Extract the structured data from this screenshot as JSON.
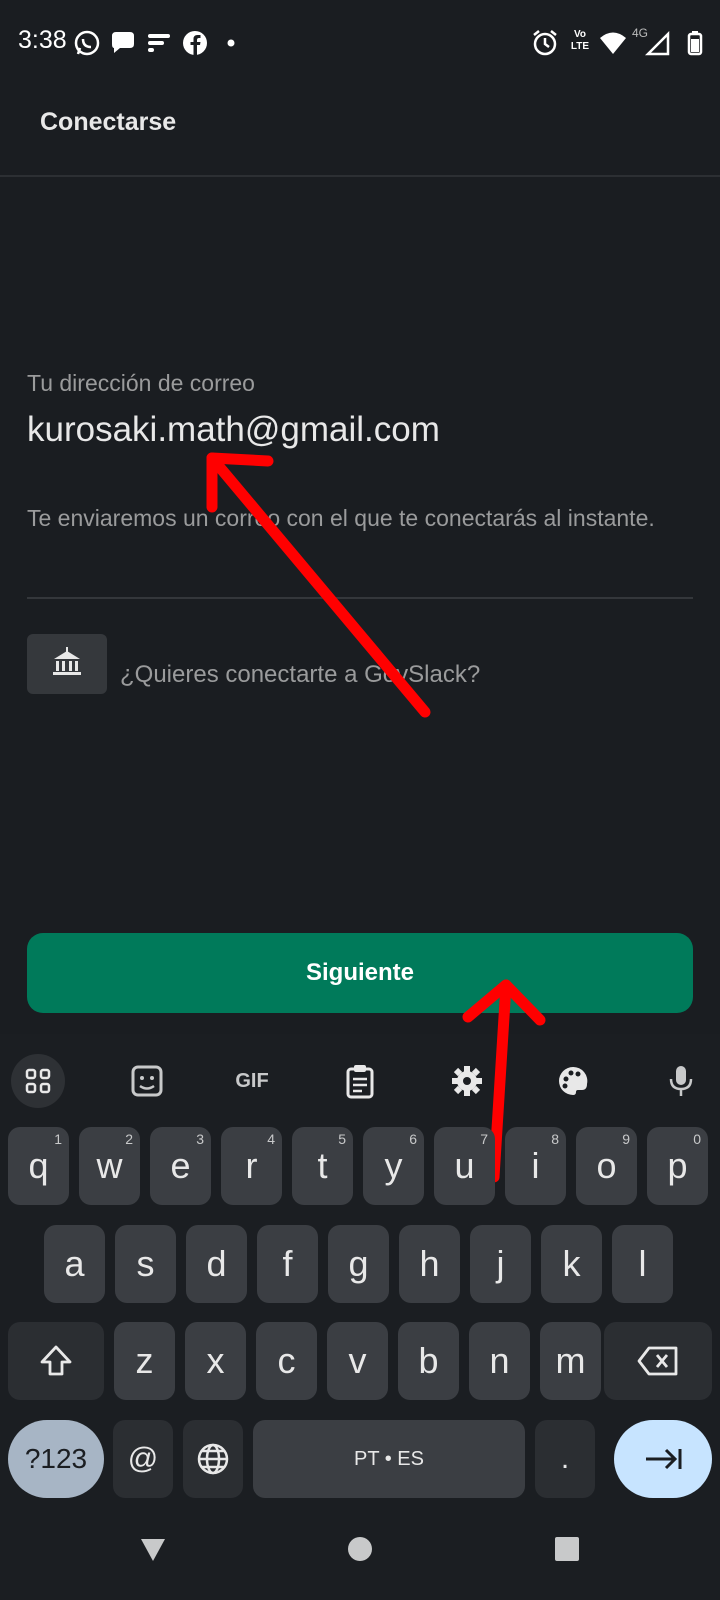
{
  "status_bar": {
    "time": "3:38",
    "network": "4G",
    "volte": "Vo LTE"
  },
  "header": {
    "title": "Conectarse"
  },
  "form": {
    "email_label": "Tu dirección de correo",
    "email_value": "kurosaki.math@gmail.com",
    "helper_text": "Te enviaremos un correo con el que te conectarás al instante.",
    "govslack_prompt": "¿Quieres conectarte a GovSlack?"
  },
  "primary_button": {
    "label": "Siguiente",
    "color": "#007a5a"
  },
  "keyboard": {
    "toolbar": [
      "apps-grid-icon",
      "sticker-icon",
      "gif-icon",
      "clipboard-icon",
      "settings-icon",
      "palette-icon",
      "mic-icon"
    ],
    "gif_label": "GIF",
    "row1": [
      {
        "k": "q",
        "n": "1"
      },
      {
        "k": "w",
        "n": "2"
      },
      {
        "k": "e",
        "n": "3"
      },
      {
        "k": "r",
        "n": "4"
      },
      {
        "k": "t",
        "n": "5"
      },
      {
        "k": "y",
        "n": "6"
      },
      {
        "k": "u",
        "n": "7"
      },
      {
        "k": "i",
        "n": "8"
      },
      {
        "k": "o",
        "n": "9"
      },
      {
        "k": "p",
        "n": "0"
      }
    ],
    "row2": [
      "a",
      "s",
      "d",
      "f",
      "g",
      "h",
      "j",
      "k",
      "l"
    ],
    "row3": [
      "z",
      "x",
      "c",
      "v",
      "b",
      "n",
      "m"
    ],
    "symbols_label": "?123",
    "at_label": "@",
    "space_label": "PT • ES",
    "period_label": "."
  },
  "annotation_color": "#ff0000"
}
